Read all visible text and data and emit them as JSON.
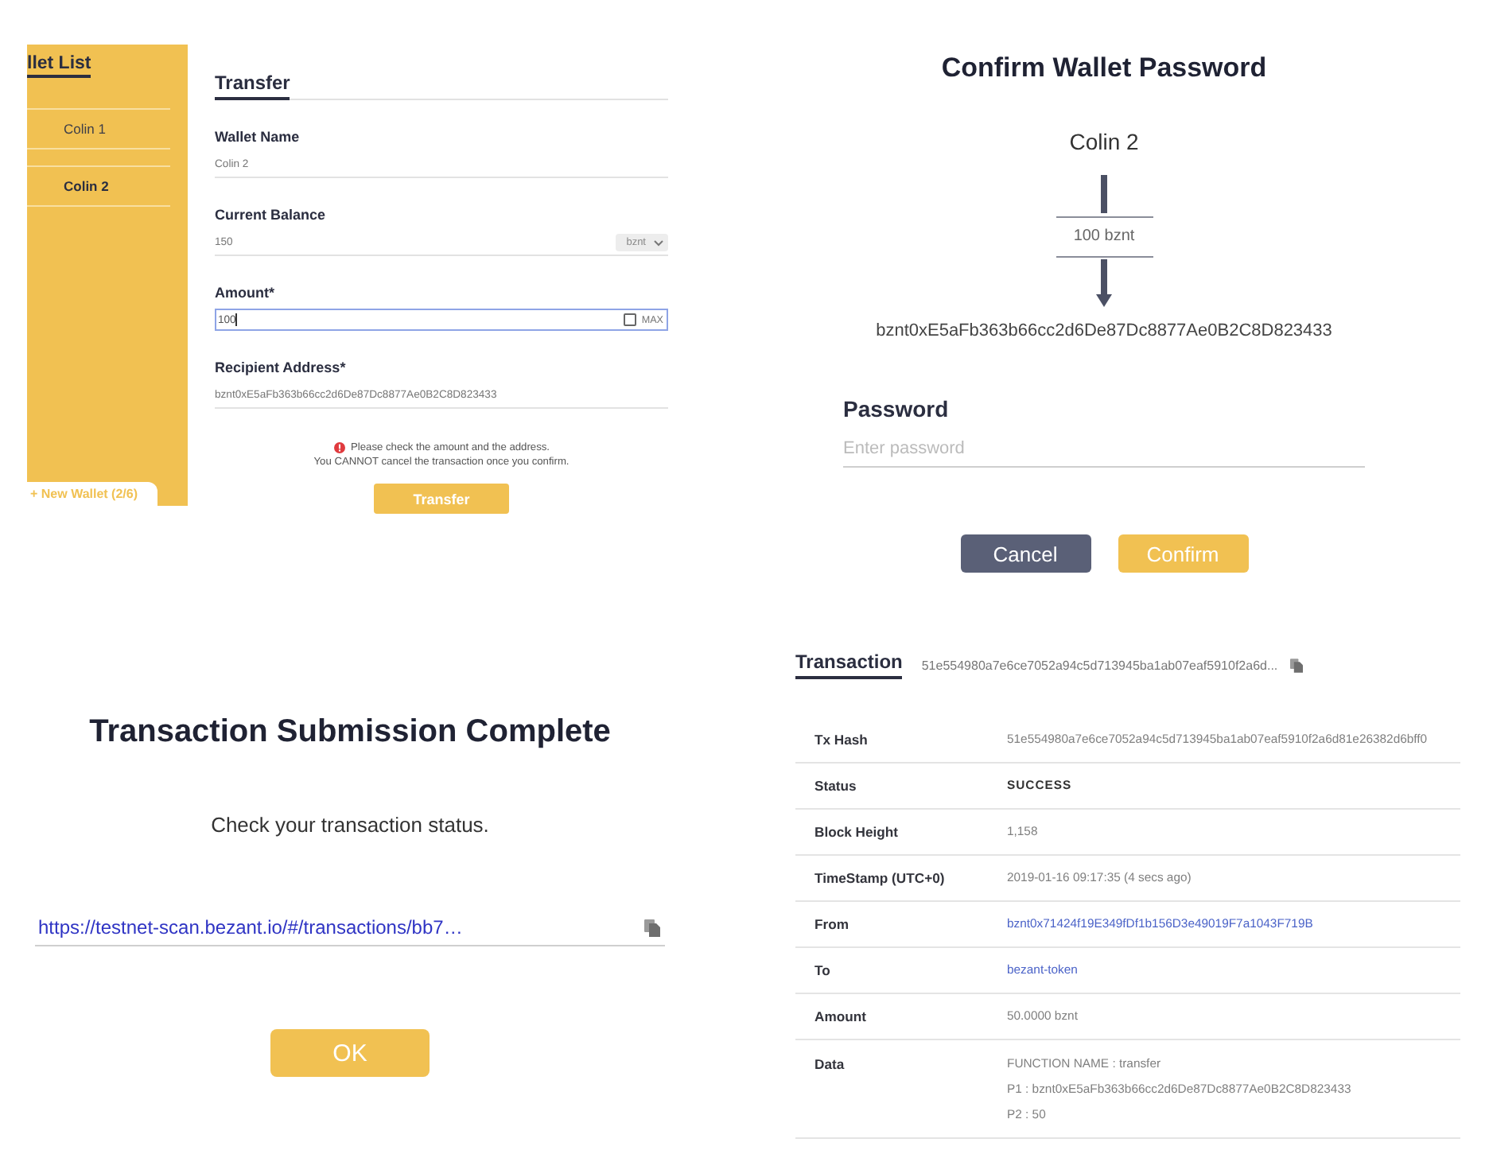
{
  "transfer_screen": {
    "sidebar": {
      "title": "llet List",
      "items": [
        {
          "label": "Colin 1",
          "selected": false
        },
        {
          "label": "Colin 2",
          "selected": true
        }
      ],
      "new_wallet_button": "+ New Wallet (2/6)"
    },
    "tab": "Transfer",
    "fields": [
      {
        "kind": "text",
        "label": "Wallet Name",
        "value": "Colin 2"
      },
      {
        "kind": "select",
        "label": "Current Balance",
        "value": "150",
        "unit": "bznt"
      },
      {
        "kind": "input",
        "label": "Amount*",
        "value": "100",
        "focused": true,
        "checkbox_label": "MAX",
        "checked": false
      },
      {
        "kind": "text",
        "label": "Recipient Address*",
        "value": "bznt0xE5aFb363b66cc2d6De87Dc8877Ae0B2C8D823433"
      }
    ],
    "warning": [
      "Please check the amount and the address.",
      "You CANNOT cancel the transaction once you confirm."
    ],
    "submit_button": "Transfer"
  },
  "password_dialog": {
    "title": "Confirm Wallet Password",
    "from": "Colin 2",
    "amount": "100 bznt",
    "to": "bznt0xE5aFb363b66cc2d6De87Dc8877Ae0B2C8D823433",
    "password_label": "Password",
    "password_placeholder": "Enter password",
    "buttons": [
      {
        "label": "Cancel",
        "kind": "secondary"
      },
      {
        "label": "Confirm",
        "kind": "primary"
      }
    ]
  },
  "submission_dialog": {
    "title": "Transaction Submission Complete",
    "message": "Check your transaction status.",
    "link": "https://testnet-scan.bezant.io/#/transactions/bb7…",
    "button": "OK"
  },
  "transaction_details": {
    "tab": "Transaction",
    "hash": "51e554980a7e6ce7052a94c5d713945ba1ab07eaf5910f2a6d...",
    "rows": [
      {
        "label": "Tx Hash",
        "kind": "text",
        "value": "51e554980a7e6ce7052a94c5d713945ba1ab07eaf5910f2a6d81e26382d6bff0"
      },
      {
        "label": "Status",
        "kind": "status",
        "value": "SUCCESS"
      },
      {
        "label": "Block Height",
        "kind": "text",
        "value": "1,158"
      },
      {
        "label": "TimeStamp (UTC+0)",
        "kind": "text",
        "value": "2019-01-16 09:17:35 (4 secs ago)"
      },
      {
        "label": "From",
        "kind": "link",
        "value": "bznt0x71424f19E349fDf1b156D3e49019F7a1043F719B"
      },
      {
        "label": "To",
        "kind": "link",
        "value": "bezant-token"
      },
      {
        "label": "Amount",
        "kind": "text",
        "value": "50.0000 bznt"
      },
      {
        "label": "Data",
        "kind": "lines",
        "lines": [
          "FUNCTION NAME : transfer",
          "P1 : bznt0xE5aFb363b66cc2d6De87Dc8877Ae0B2C8D823433",
          "P2 : 50"
        ]
      }
    ]
  }
}
